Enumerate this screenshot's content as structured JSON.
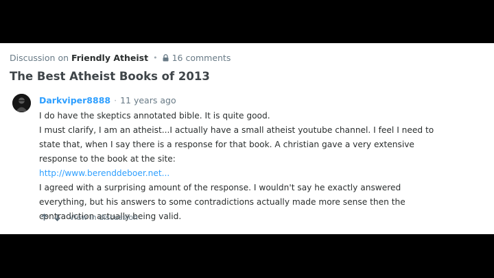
{
  "header": {
    "discussion_prefix": "Discussion on",
    "site_name": "Friendly Atheist",
    "separator": "•",
    "comments_count": "16 comments"
  },
  "thread_title": "The Best Atheist Books of 2013",
  "comment": {
    "author": "Darkviper8888",
    "separator": "·",
    "time": "11 years ago",
    "paragraphs": [
      "I do have the skeptics annotated bible. It is quite good.",
      "I must clarify, I am an atheist...I actually have a small atheist youtube channel. I feel I need to state that, when I say there is a response for that book. A christian gave a very extensive response to the book at the site:"
    ],
    "link": "http://www.berenddeboer.net...",
    "closing": "I agreed with a surprising amount of the response. I wouldn't say he exactly answered everything, but his answers to some contradictions actually made more sense then the contradiction actually being valid.",
    "actions": {
      "upvote_icon": "arrow-up-icon",
      "downvote_icon": "arrow-down-icon",
      "view_label": "View in discussion"
    }
  },
  "colors": {
    "link": "#2e9fff",
    "text": "#2a2e2e",
    "muted": "#687a86"
  }
}
